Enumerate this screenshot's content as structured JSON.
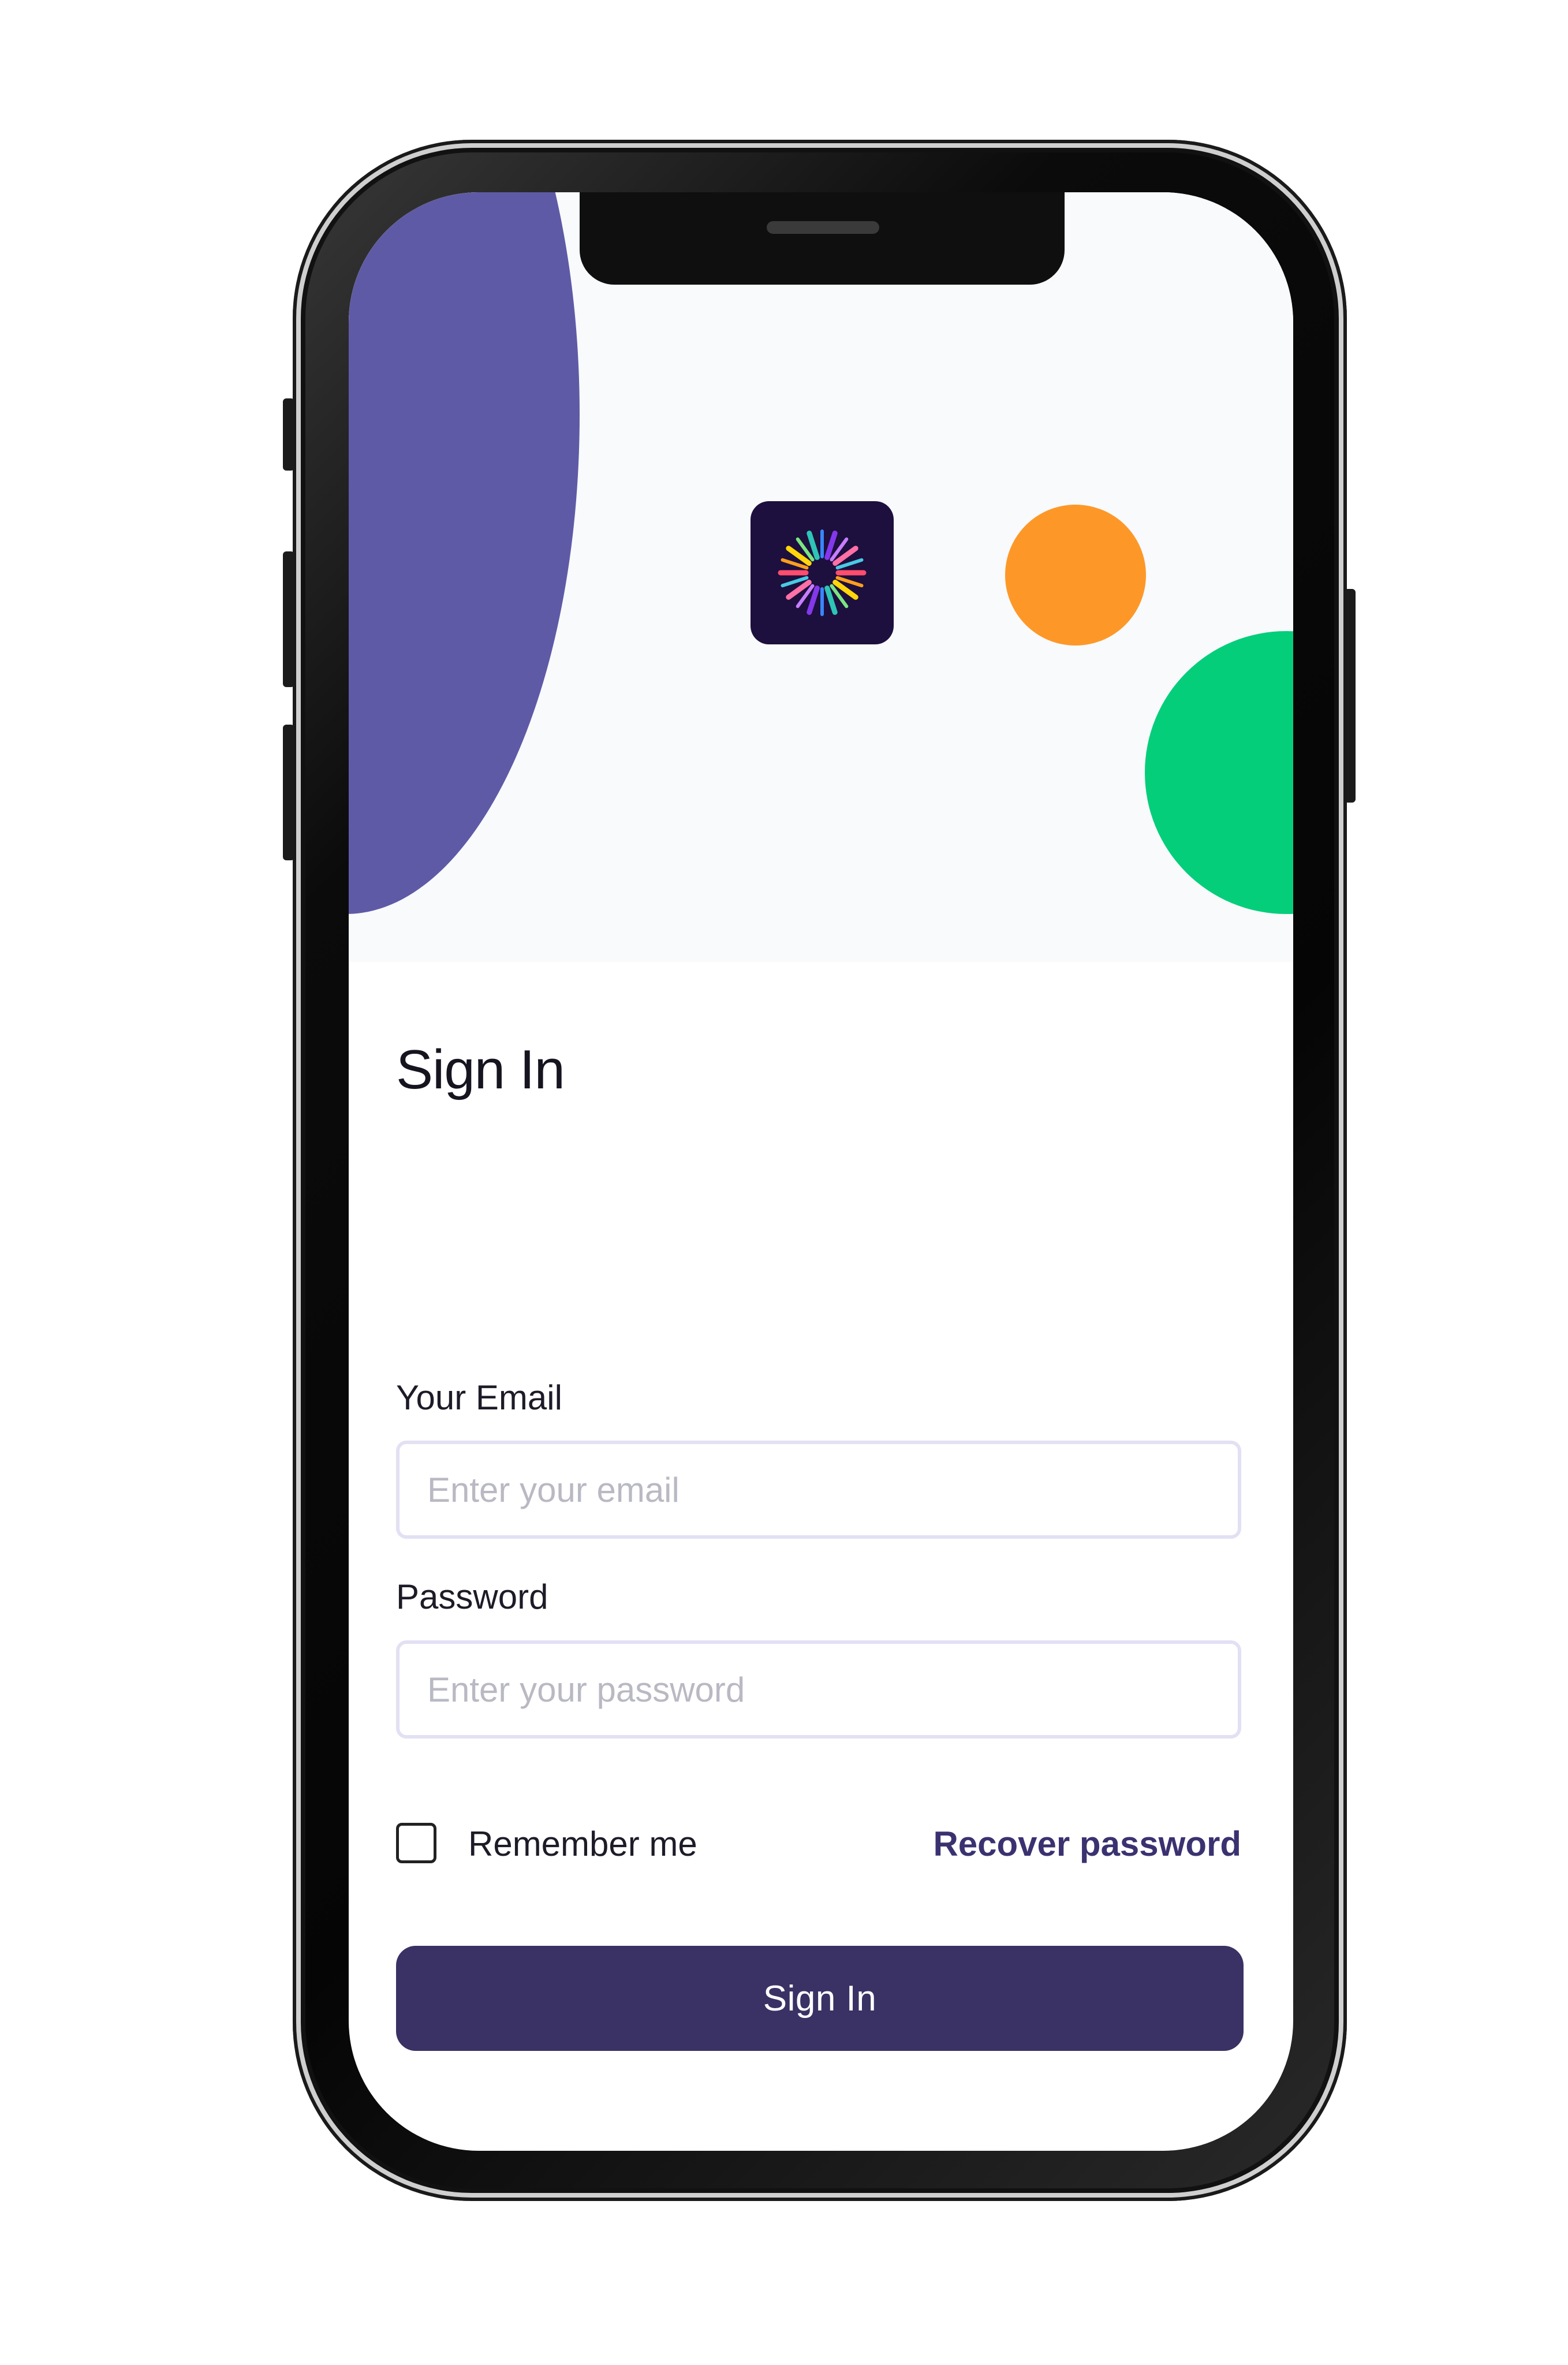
{
  "colors": {
    "hero_background": "#f8fafc",
    "purple_circle": "#5f5aa6",
    "orange_circle": "#fd9828",
    "green_circle": "#05ce7b",
    "logo_background": "#1d0f3e",
    "primary_button": "#3a3164",
    "link": "#3a3270",
    "input_border": "#e2e0f3"
  },
  "icons": {
    "app_logo": "burst-logo-icon"
  },
  "form": {
    "title": "Sign In",
    "email_label": "Your Email",
    "email_placeholder": "Enter your email",
    "email_value": "",
    "password_label": "Password",
    "password_placeholder": "Enter your password",
    "password_value": "",
    "remember_label": "Remember me",
    "remember_checked": false,
    "recover_link": "Recover password",
    "submit_label": "Sign In"
  }
}
